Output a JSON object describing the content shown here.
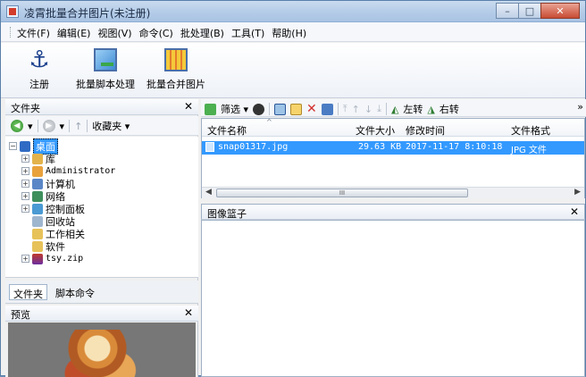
{
  "window": {
    "title": "凌霄批量合并图片(未注册)",
    "controls": {
      "minimize": "–",
      "maximize": "□",
      "close": "✕"
    }
  },
  "menu": [
    "文件(F)",
    "编辑(E)",
    "视图(V)",
    "命令(C)",
    "批处理(B)",
    "工具(T)",
    "帮助(H)"
  ],
  "toolbar": {
    "register": "注册",
    "batch_script": "批量脚本处理",
    "batch_merge": "批量合并图片"
  },
  "folder_panel": {
    "title": "文件夹",
    "close": "✕",
    "nav": {
      "favorites": "收藏夹 ▾",
      "back": "◀",
      "forward": "▶",
      "up": "↑"
    },
    "tree": [
      {
        "label": "桌面",
        "level": 0,
        "selected": true,
        "mono": false
      },
      {
        "label": "库",
        "level": 1,
        "selected": false,
        "mono": false
      },
      {
        "label": "Administrator",
        "level": 1,
        "selected": false,
        "mono": true
      },
      {
        "label": "计算机",
        "level": 1,
        "selected": false,
        "mono": false
      },
      {
        "label": "网络",
        "level": 1,
        "selected": false,
        "mono": false
      },
      {
        "label": "控制面板",
        "level": 1,
        "selected": false,
        "mono": false
      },
      {
        "label": "回收站",
        "level": 1,
        "selected": false,
        "mono": false
      },
      {
        "label": "工作相关",
        "level": 1,
        "selected": false,
        "mono": false
      },
      {
        "label": "软件",
        "level": 1,
        "selected": false,
        "mono": false
      },
      {
        "label": "tsy.zip",
        "level": 1,
        "selected": false,
        "mono": true
      }
    ],
    "tabs": {
      "folder": "文件夹",
      "script": "脚本命令"
    }
  },
  "preview": {
    "title": "预览",
    "close": "✕"
  },
  "right_toolbar": {
    "filter": "筛选 ▾",
    "rotate_left": "左转",
    "rotate_right": "右转",
    "more": "»"
  },
  "file_list": {
    "columns": {
      "name": "文件名称",
      "size": "文件大小",
      "modified": "修改时间",
      "format": "文件格式"
    },
    "sort_indicator": "^",
    "rows": [
      {
        "name": "snap01317.jpg",
        "size": "29.63 KB",
        "modified": "2017-11-17 8:10:18",
        "format": "JPG 文件"
      }
    ],
    "hscroll": {
      "left": "◀",
      "right": "▶",
      "thumb": "III"
    }
  },
  "basket": {
    "title": "图像篮子",
    "close": "✕"
  }
}
